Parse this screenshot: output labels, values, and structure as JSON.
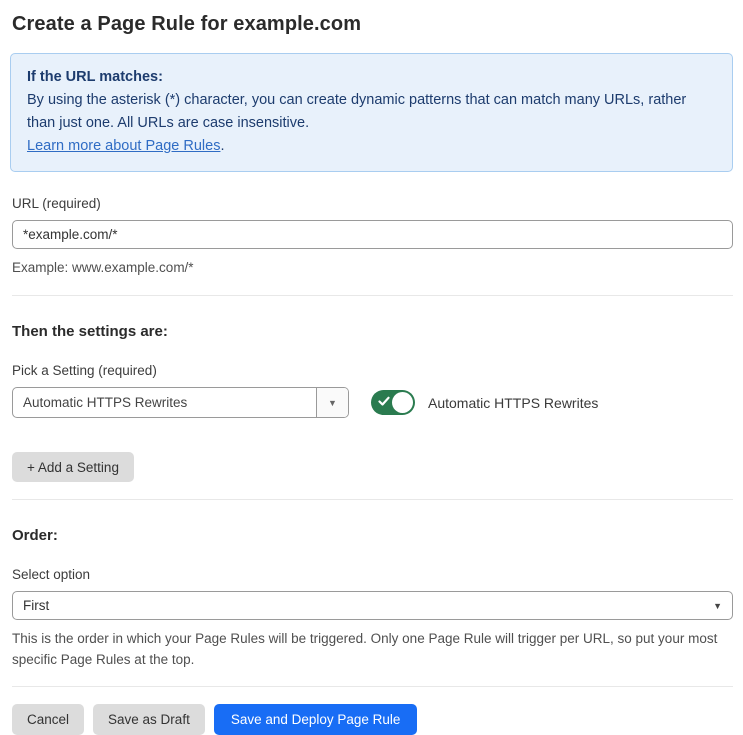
{
  "page": {
    "title": "Create a Page Rule for example.com"
  },
  "info_box": {
    "heading": "If the URL matches:",
    "body": "By using the asterisk (*) character, you can create dynamic patterns that can match many URLs, rather than just one. All URLs are case insensitive.",
    "link_label": "Learn more about Page Rules",
    "link_suffix": "."
  },
  "url_field": {
    "label": "URL (required)",
    "value": "*example.com/*",
    "helper": "Example: www.example.com/*"
  },
  "settings_section": {
    "heading": "Then the settings are:",
    "picker_label": "Pick a Setting (required)",
    "picker_value": "Automatic HTTPS Rewrites",
    "picker_arrow": "▼",
    "toggle_state": "on",
    "toggle_label": "Automatic HTTPS Rewrites",
    "add_setting_label": "+ Add a Setting"
  },
  "order_section": {
    "heading": "Order:",
    "select_label": "Select option",
    "select_value": "First",
    "select_arrow": "▼",
    "helper": "This is the order in which your Page Rules will be triggered. Only one Page Rule will trigger per URL, so put your most specific Page Rules at the top."
  },
  "footer": {
    "cancel_label": "Cancel",
    "save_draft_label": "Save as Draft",
    "save_deploy_label": "Save and Deploy Page Rule"
  },
  "colors": {
    "info_box_bg": "#e8f1fb",
    "info_box_border": "#a9cdf0",
    "info_box_text": "#1d3c6e",
    "link": "#2f6cc4",
    "toggle_on": "#2a7b4f",
    "primary_button": "#186df5",
    "gray_button": "#dcdcdc"
  }
}
